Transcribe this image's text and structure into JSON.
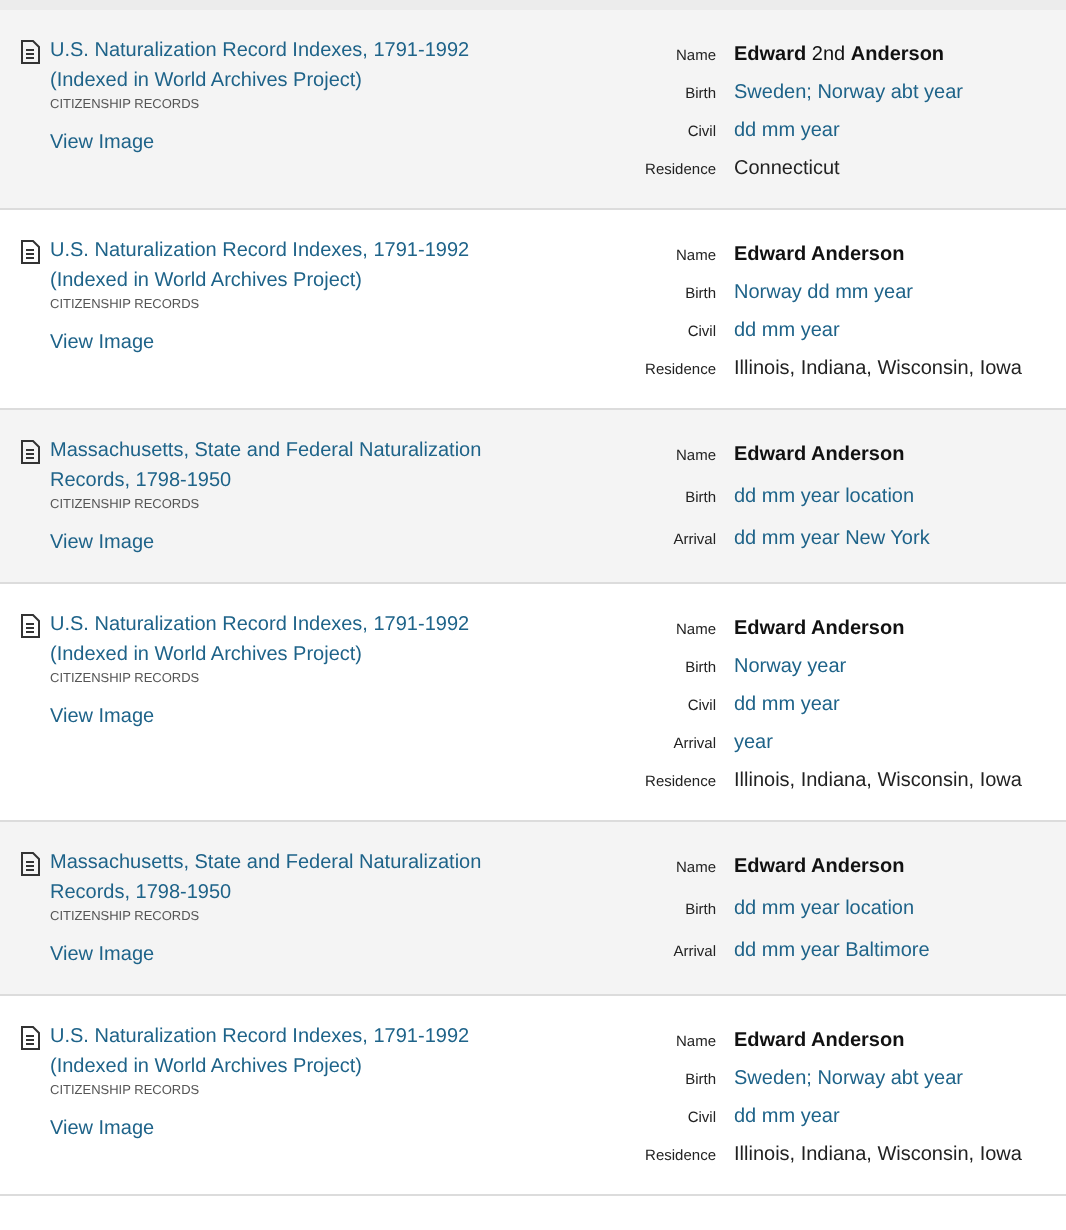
{
  "records": [
    {
      "title": "U.S. Naturalization Record Indexes, 1791-1992 (Indexed in World Archives Project)",
      "category": "CITIZENSHIP RECORDS",
      "link": "View Image",
      "fields": [
        {
          "label": "Name",
          "value": "**Edward** 2nd **Anderson**",
          "kind": "name"
        },
        {
          "label": "Birth",
          "value": "Sweden; Norway abt year",
          "kind": "link"
        },
        {
          "label": "Civil",
          "value": "dd mm year",
          "kind": "link"
        },
        {
          "label": "Residence",
          "value": "Connecticut",
          "kind": "text"
        }
      ]
    },
    {
      "title": "U.S. Naturalization Record Indexes, 1791-1992 (Indexed in World Archives Project)",
      "category": "CITIZENSHIP RECORDS",
      "link": "View Image",
      "fields": [
        {
          "label": "Name",
          "value": "**Edward Anderson**",
          "kind": "name"
        },
        {
          "label": "Birth",
          "value": "Norway dd mm year",
          "kind": "link"
        },
        {
          "label": "Civil",
          "value": "dd mm year",
          "kind": "link"
        },
        {
          "label": "Residence",
          "value": "Illinois, Indiana, Wisconsin, Iowa",
          "kind": "text"
        }
      ]
    },
    {
      "title": "Massachusetts, State and Federal Naturalization Records, 1798-1950",
      "category": "CITIZENSHIP RECORDS",
      "link": "View Image",
      "fields": [
        {
          "label": "Name",
          "value": "**Edward Anderson**",
          "kind": "name"
        },
        {
          "label": "Birth",
          "value": "dd mm year location",
          "kind": "link"
        },
        {
          "label": "Arrival",
          "value": "dd mm year New York",
          "kind": "link"
        }
      ]
    },
    {
      "title": "U.S. Naturalization Record Indexes, 1791-1992 (Indexed in World Archives Project)",
      "category": "CITIZENSHIP RECORDS",
      "link": "View Image",
      "fields": [
        {
          "label": "Name",
          "value": "**Edward Anderson**",
          "kind": "name"
        },
        {
          "label": "Birth",
          "value": "Norway year",
          "kind": "link"
        },
        {
          "label": "Civil",
          "value": "dd mm year",
          "kind": "link"
        },
        {
          "label": "Arrival",
          "value": "year",
          "kind": "link"
        },
        {
          "label": "Residence",
          "value": "Illinois, Indiana, Wisconsin, Iowa",
          "kind": "text"
        }
      ]
    },
    {
      "title": "Massachusetts, State and Federal Naturalization Records, 1798-1950",
      "category": "CITIZENSHIP RECORDS",
      "link": "View Image",
      "fields": [
        {
          "label": "Name",
          "value": "**Edward Anderson**",
          "kind": "name"
        },
        {
          "label": "Birth",
          "value": "dd mm year location",
          "kind": "link"
        },
        {
          "label": "Arrival",
          "value": "dd mm year Baltimore",
          "kind": "link"
        }
      ]
    },
    {
      "title": "U.S. Naturalization Record Indexes, 1791-1992 (Indexed in World Archives Project)",
      "category": "CITIZENSHIP RECORDS",
      "link": "View Image",
      "fields": [
        {
          "label": "Name",
          "value": "**Edward Anderson**",
          "kind": "name"
        },
        {
          "label": "Birth",
          "value": "Sweden; Norway abt year",
          "kind": "link"
        },
        {
          "label": "Civil",
          "value": "dd mm year",
          "kind": "link"
        },
        {
          "label": "Residence",
          "value": "Illinois, Indiana, Wisconsin, Iowa",
          "kind": "text"
        }
      ]
    }
  ]
}
